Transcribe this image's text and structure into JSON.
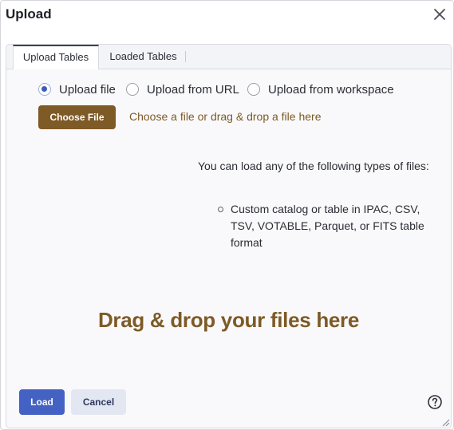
{
  "dialog": {
    "title": "Upload",
    "close_icon": "close-icon"
  },
  "tabs": [
    {
      "label": "Upload Tables",
      "active": true
    },
    {
      "label": "Loaded Tables",
      "active": false
    }
  ],
  "source_options": [
    {
      "label": "Upload file",
      "selected": true
    },
    {
      "label": "Upload from URL",
      "selected": false
    },
    {
      "label": "Upload from workspace",
      "selected": false
    }
  ],
  "file_picker": {
    "button_label": "Choose File",
    "hint": "Choose a file or drag & drop a file here"
  },
  "file_types": {
    "intro": "You can load any of the following types of files:",
    "items": [
      "Custom catalog or table in IPAC, CSV, TSV, VOTABLE, Parquet, or FITS table format"
    ]
  },
  "drop_zone": {
    "text": "Drag & drop your files here"
  },
  "footer": {
    "load_label": "Load",
    "cancel_label": "Cancel",
    "help_icon": "help-icon"
  },
  "colors": {
    "accent": "#7d5a26",
    "primary": "#4461c4",
    "secondary": "#e3e7f2"
  }
}
